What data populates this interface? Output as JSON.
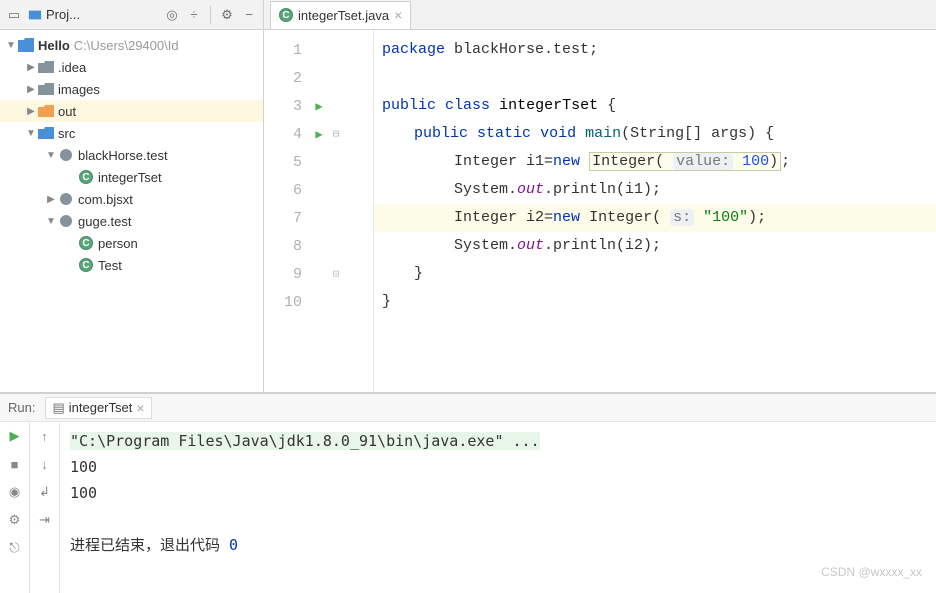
{
  "sidebar": {
    "title": "Proj...",
    "tree": {
      "root": {
        "name": "Hello",
        "path": "C:\\Users\\29400\\Id"
      },
      "items": [
        {
          "label": ".idea"
        },
        {
          "label": "images"
        },
        {
          "label": "out"
        },
        {
          "label": "src"
        },
        {
          "label": "blackHorse.test"
        },
        {
          "label": "integerTset"
        },
        {
          "label": "com.bjsxt"
        },
        {
          "label": "guge.test"
        },
        {
          "label": "person"
        },
        {
          "label": "Test"
        }
      ]
    }
  },
  "editor": {
    "tab": {
      "label": "integerTset.java"
    },
    "lines": [
      "1",
      "2",
      "3",
      "4",
      "5",
      "6",
      "7",
      "8",
      "9",
      "10"
    ],
    "code": {
      "pkg": "package",
      "pkgName": "blackHorse.test",
      "public": "public",
      "class": "class",
      "className": "integerTset",
      "static": "static",
      "void": "void",
      "main": "main",
      "args": "(String[] args) {",
      "integer": "Integer",
      "i1": "i1=",
      "i2": "i2=",
      "new": "new",
      "intCtor": "Integer",
      "hint1": "value:",
      "val1": "100",
      "hint2": "s:",
      "val2": "\"100\"",
      "system": "System.",
      "out": "out",
      "println": ".println",
      "arg1": "(i1);",
      "arg2": "(i2);",
      "closeBrace": "}"
    }
  },
  "run": {
    "title": "Run:",
    "tab": "integerTset",
    "output": {
      "cmd": "\"C:\\Program Files\\Java\\jdk1.8.0_91\\bin\\java.exe\" ...",
      "line1": "100",
      "line2": "100",
      "exitText": "进程已结束，退出代码 ",
      "exitCode": "0"
    }
  },
  "watermark": "CSDN @wxxxx_xx"
}
